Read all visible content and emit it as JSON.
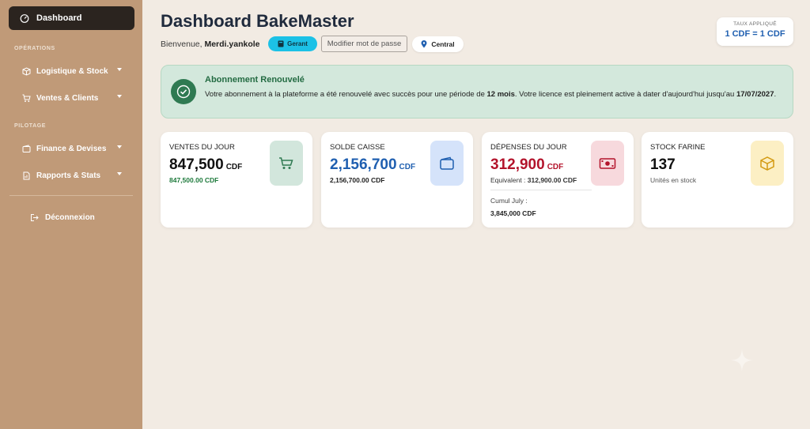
{
  "sidebar": {
    "active_item": "Dashboard",
    "section_operations": "OPÉRATIONS",
    "section_pilotage": "PILOTAGE",
    "items": [
      {
        "label": "Logistique & Stock",
        "icon": "box-icon"
      },
      {
        "label": "Ventes & Clients",
        "icon": "cart-icon"
      },
      {
        "label": "Finance & Devises",
        "icon": "wallet-icon"
      },
      {
        "label": "Rapports & Stats",
        "icon": "report-icon"
      }
    ],
    "logout_label": "Déconnexion"
  },
  "header": {
    "title": "Dashboard BakeMaster",
    "welcome_prefix": "Bienvenue,",
    "username": "Merdi.yankole",
    "role": "Gerant",
    "change_password_label": "Modifier mot de passe",
    "branch": "Central",
    "rate_label": "TAUX APPLIQUÉ",
    "rate_value": "1 CDF = 1 CDF"
  },
  "alert": {
    "title": "Abonnement Renouvelé",
    "text_1": "Votre abonnement à la plateforme a été renouvelé avec succès pour une période de ",
    "period": "12 mois",
    "text_2": ". Votre licence est pleinement active à dater d'aujourd'hui jusqu'au ",
    "end_date": "17/07/2027",
    "text_3": "."
  },
  "cards": [
    {
      "label": "VENTES DU JOUR",
      "value": "847,500",
      "unit": "CDF",
      "sub": "847,500.00 CDF",
      "color": "#1e7a3c",
      "icon_bg": "#d2e6dc"
    },
    {
      "label": "SOLDE CAISSE",
      "value": "2,156,700",
      "unit": "CDF",
      "sub": "2,156,700.00 CDF",
      "color": "#1f5fb0",
      "icon_bg": "#d5e3fa"
    },
    {
      "label": "DÉPENSES DU JOUR",
      "value": "312,900",
      "unit": "CDF",
      "sub_prefix": "Equivalent : ",
      "sub": "312,900.00 CDF",
      "note": "Cumul July :",
      "note_value": "3,845,000 CDF",
      "color": "#b3132b",
      "icon_bg": "#f7d9dd"
    },
    {
      "label": "STOCK FARINE",
      "value": "137",
      "sub": "Unités en stock",
      "color": "#111111",
      "icon_bg": "#fcefc4"
    }
  ]
}
